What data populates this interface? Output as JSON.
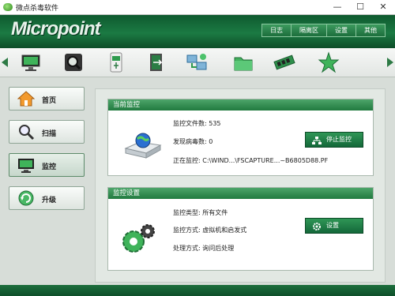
{
  "window": {
    "title": "微点杀毒软件",
    "controls": [
      "—",
      "☐",
      "✕"
    ]
  },
  "brand": {
    "logo": "Micropoint"
  },
  "top_menu": [
    "日志",
    "隔离区",
    "设置",
    "其他"
  ],
  "toolbar_icons": [
    "monitor-icon",
    "magnifier-icon",
    "usb-drive-icon",
    "exit-door-icon",
    "network-computers-icon",
    "folder-icon",
    "memory-module-icon",
    "star-icon"
  ],
  "nav": [
    {
      "label": "首页",
      "icon": "home-icon"
    },
    {
      "label": "扫描",
      "icon": "magnifier-icon"
    },
    {
      "label": "监控",
      "icon": "monitor-icon",
      "active": true
    },
    {
      "label": "升级",
      "icon": "update-icon"
    }
  ],
  "current_monitor": {
    "title": "当前监控",
    "files_monitored": "监控文件数: 535",
    "viruses_found": "发现病毒数: 0",
    "monitoring": "正在监控:    C:\\WIND...\\FSCAPTURE...~B6805D88.PF",
    "stop_button": "停止监控"
  },
  "monitor_settings": {
    "title": "监控设置",
    "type": "监控类型: 所有文件",
    "mode": "监控方式: 虚拟机和启发式",
    "handling": "处理方式: 询问后处理",
    "settings_button": "设置"
  },
  "colors": {
    "brand_green": "#1b7a43",
    "panel_header": "#2f8c50"
  }
}
